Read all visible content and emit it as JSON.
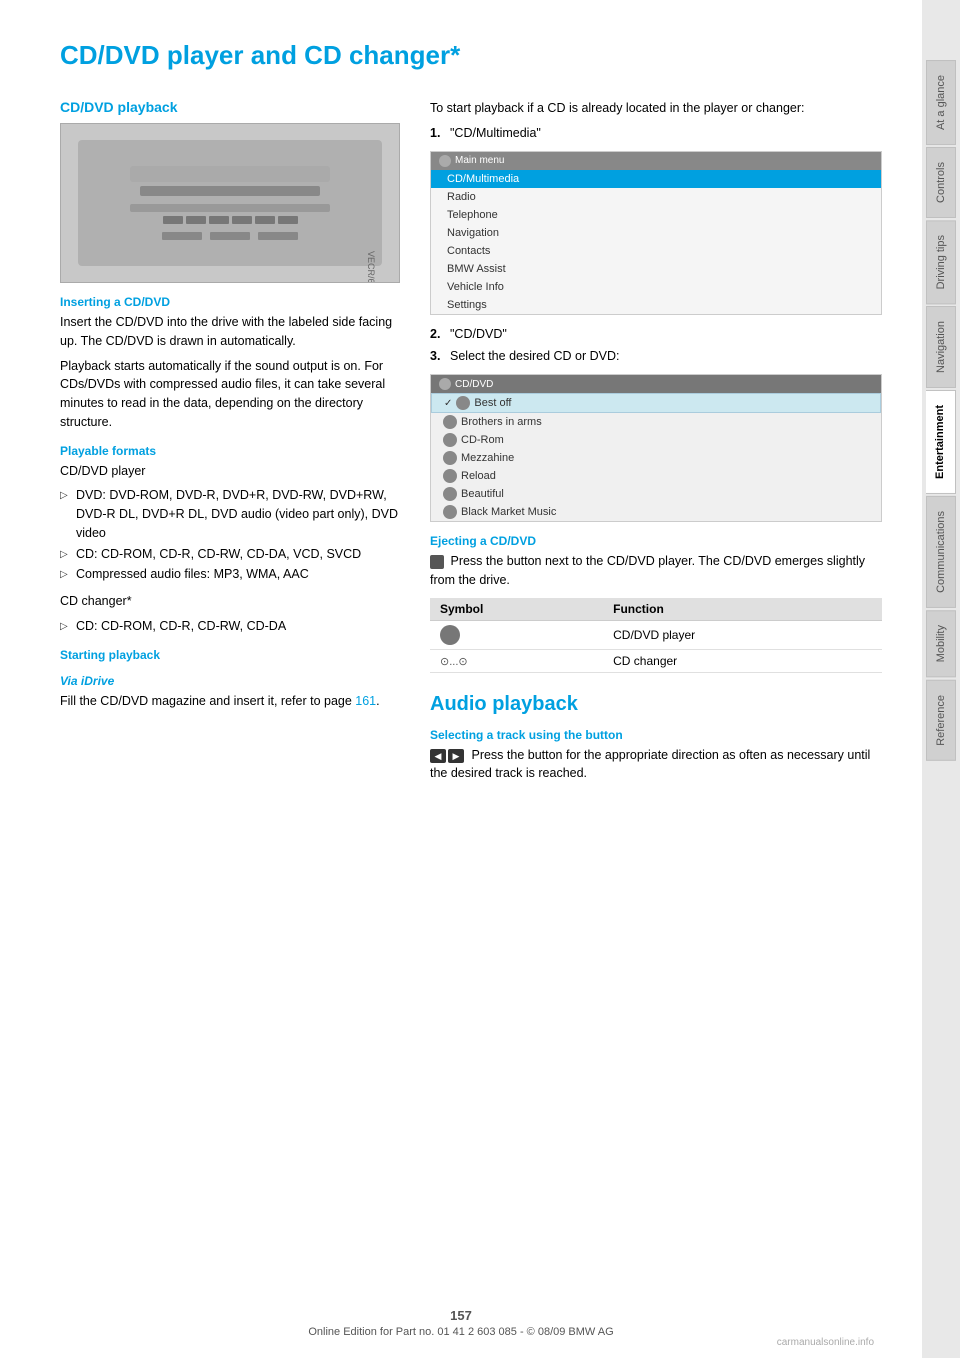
{
  "page": {
    "title": "CD/DVD player and CD changer*",
    "number": "157",
    "footer_text": "Online Edition for Part no. 01 41 2 603 085 - © 08/09 BMW AG"
  },
  "sidebar": {
    "tabs": [
      {
        "label": "At a glance",
        "active": false
      },
      {
        "label": "Controls",
        "active": false
      },
      {
        "label": "Driving tips",
        "active": false
      },
      {
        "label": "Navigation",
        "active": false
      },
      {
        "label": "Entertainment",
        "active": true
      },
      {
        "label": "Communications",
        "active": false
      },
      {
        "label": "Mobility",
        "active": false
      },
      {
        "label": "Reference",
        "active": false
      }
    ]
  },
  "left_column": {
    "section1_heading": "CD/DVD playback",
    "inserting_heading": "Inserting a CD/DVD",
    "inserting_text1": "Insert the CD/DVD into the drive with the labeled side facing up. The CD/DVD is drawn in automatically.",
    "inserting_text2": "Playback starts automatically if the sound output is on. For CDs/DVDs with compressed audio files, it can take several minutes to read in the data, depending on the directory structure.",
    "playable_heading": "Playable formats",
    "cd_dvd_player_label": "CD/DVD player",
    "dvd_formats": "DVD: DVD-ROM, DVD-R, DVD+R, DVD-RW, DVD+RW, DVD-R DL, DVD+R DL, DVD audio (video part only), DVD video",
    "cd_formats": "CD: CD-ROM, CD-R, CD-RW, CD-DA, VCD, SVCD",
    "compressed_formats": "Compressed audio files: MP3, WMA, AAC",
    "cd_changer_label": "CD changer*",
    "cd_changer_formats": "CD: CD-ROM, CD-R, CD-RW, CD-DA",
    "starting_heading": "Starting playback",
    "via_idrive_heading": "Via iDrive",
    "via_idrive_text": "Fill the CD/DVD magazine and insert it, refer to page",
    "via_idrive_link": "161",
    "via_idrive_period": "."
  },
  "right_column": {
    "playback_intro": "To start playback if a CD is already located in the player or changer:",
    "step1": "\"CD/Multimedia\"",
    "step2": "\"CD/DVD\"",
    "step3": "Select the desired CD or DVD:",
    "main_menu_title": "Main menu",
    "menu_items": [
      {
        "label": "CD/Multimedia",
        "highlighted": true
      },
      {
        "label": "Radio",
        "highlighted": false
      },
      {
        "label": "Telephone",
        "highlighted": false
      },
      {
        "label": "Navigation",
        "highlighted": false
      },
      {
        "label": "Contacts",
        "highlighted": false
      },
      {
        "label": "BMW Assist",
        "highlighted": false
      },
      {
        "label": "Vehicle Info",
        "highlighted": false
      },
      {
        "label": "Settings",
        "highlighted": false
      }
    ],
    "cd_dvd_menu_title": "CD/DVD",
    "cd_dvd_menu_items": [
      {
        "label": "Best off",
        "highlighted": true,
        "has_check": true
      },
      {
        "label": "Brothers in arms",
        "highlighted": false
      },
      {
        "label": "CD-Rom",
        "highlighted": false
      },
      {
        "label": "Mezzahine",
        "highlighted": false
      },
      {
        "label": "Reload",
        "highlighted": false
      },
      {
        "label": "Beautiful",
        "highlighted": false
      },
      {
        "label": "Black Market Music",
        "highlighted": false
      }
    ],
    "ejecting_heading": "Ejecting a CD/DVD",
    "ejecting_text": "Press the button next to the CD/DVD player. The CD/DVD emerges slightly from the drive.",
    "symbol_col_header": "Symbol",
    "function_col_header": "Function",
    "symbol_rows": [
      {
        "symbol": "disc",
        "function": "CD/DVD player"
      },
      {
        "symbol": "changer",
        "function": "CD changer"
      }
    ],
    "audio_heading": "Audio playback",
    "selecting_heading": "Selecting a track using the button",
    "selecting_text": "Press the button for the appropriate direction as often as necessary until the desired track is reached."
  }
}
